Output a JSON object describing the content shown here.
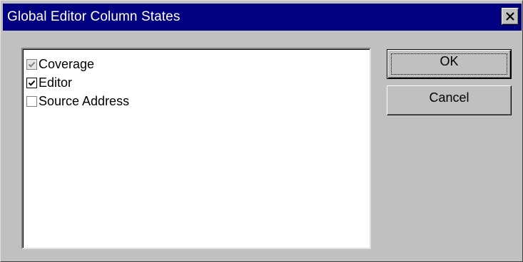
{
  "dialog": {
    "title": "Global Editor Column States",
    "close_icon": "close-icon"
  },
  "list": {
    "items": [
      {
        "label": "Coverage",
        "checked": true,
        "disabled": true
      },
      {
        "label": "Editor",
        "checked": true,
        "disabled": false
      },
      {
        "label": "Source Address",
        "checked": false,
        "disabled": false
      }
    ]
  },
  "buttons": {
    "ok_label": "OK",
    "cancel_label": "Cancel"
  },
  "colors": {
    "titlebar": "#000080",
    "face": "#c0c0c0",
    "check_disabled": "#808080"
  }
}
